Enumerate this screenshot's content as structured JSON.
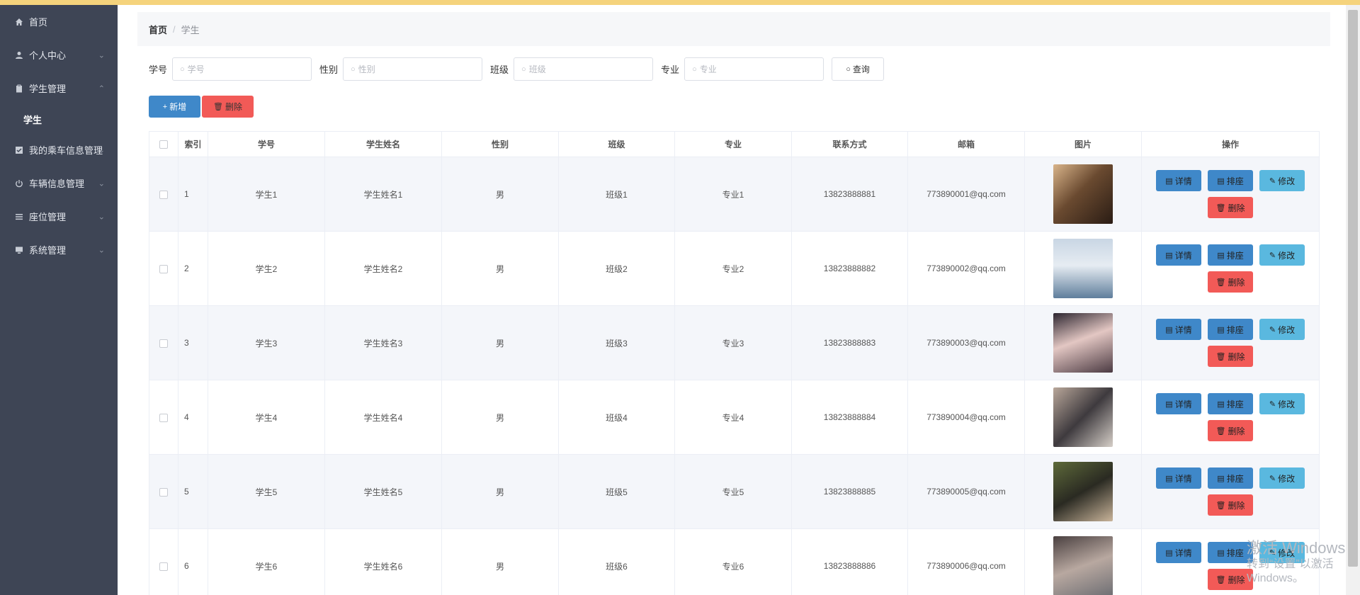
{
  "sidebar": {
    "items": [
      {
        "label": "首页",
        "icon": "home-icon",
        "arrow": ""
      },
      {
        "label": "个人中心",
        "icon": "user-icon",
        "arrow": "⌄"
      },
      {
        "label": "学生管理",
        "icon": "clipboard-icon",
        "arrow": "⌃"
      },
      {
        "label": "我的乘车信息管理",
        "icon": "checkbox-icon",
        "arrow": "⌄"
      },
      {
        "label": "车辆信息管理",
        "icon": "power-icon",
        "arrow": "⌄"
      },
      {
        "label": "座位管理",
        "icon": "list-icon",
        "arrow": "⌄"
      },
      {
        "label": "系统管理",
        "icon": "monitor-icon",
        "arrow": "⌄"
      }
    ],
    "subitem": "学生"
  },
  "breadcrumb": {
    "home": "首页",
    "sep": "/",
    "current": "学生"
  },
  "search": {
    "fields": [
      {
        "label": "学号",
        "placeholder": "学号"
      },
      {
        "label": "性别",
        "placeholder": "性别"
      },
      {
        "label": "班级",
        "placeholder": "班级"
      },
      {
        "label": "专业",
        "placeholder": "专业"
      }
    ],
    "query_label": "查询"
  },
  "actions": {
    "add_label": "新增",
    "delete_label": "删除"
  },
  "table": {
    "headers": [
      "索引",
      "学号",
      "学生姓名",
      "性别",
      "班级",
      "专业",
      "联系方式",
      "邮箱",
      "图片",
      "操作"
    ],
    "op_labels": {
      "detail": "详情",
      "rank": "排座",
      "edit": "修改",
      "delete": "删除"
    },
    "rows": [
      {
        "index": "1",
        "sid": "学生1",
        "name": "学生姓名1",
        "gender": "男",
        "cls": "班级1",
        "major": "专业1",
        "phone": "13823888881",
        "email": "773890001@qq.com"
      },
      {
        "index": "2",
        "sid": "学生2",
        "name": "学生姓名2",
        "gender": "男",
        "cls": "班级2",
        "major": "专业2",
        "phone": "13823888882",
        "email": "773890002@qq.com"
      },
      {
        "index": "3",
        "sid": "学生3",
        "name": "学生姓名3",
        "gender": "男",
        "cls": "班级3",
        "major": "专业3",
        "phone": "13823888883",
        "email": "773890003@qq.com"
      },
      {
        "index": "4",
        "sid": "学生4",
        "name": "学生姓名4",
        "gender": "男",
        "cls": "班级4",
        "major": "专业4",
        "phone": "13823888884",
        "email": "773890004@qq.com"
      },
      {
        "index": "5",
        "sid": "学生5",
        "name": "学生姓名5",
        "gender": "男",
        "cls": "班级5",
        "major": "专业5",
        "phone": "13823888885",
        "email": "773890005@qq.com"
      },
      {
        "index": "6",
        "sid": "学生6",
        "name": "学生姓名6",
        "gender": "男",
        "cls": "班级6",
        "major": "专业6",
        "phone": "13823888886",
        "email": "773890006@qq.com"
      }
    ]
  },
  "watermark": {
    "line1": "激活 Windows",
    "line2": "转到“设置”以激活 Windows。"
  },
  "colors": {
    "sidebar": "#3e4555",
    "primary": "#3f88c9",
    "danger": "#f25a57",
    "info": "#5ab8df",
    "topbar": "#f5d37c"
  }
}
